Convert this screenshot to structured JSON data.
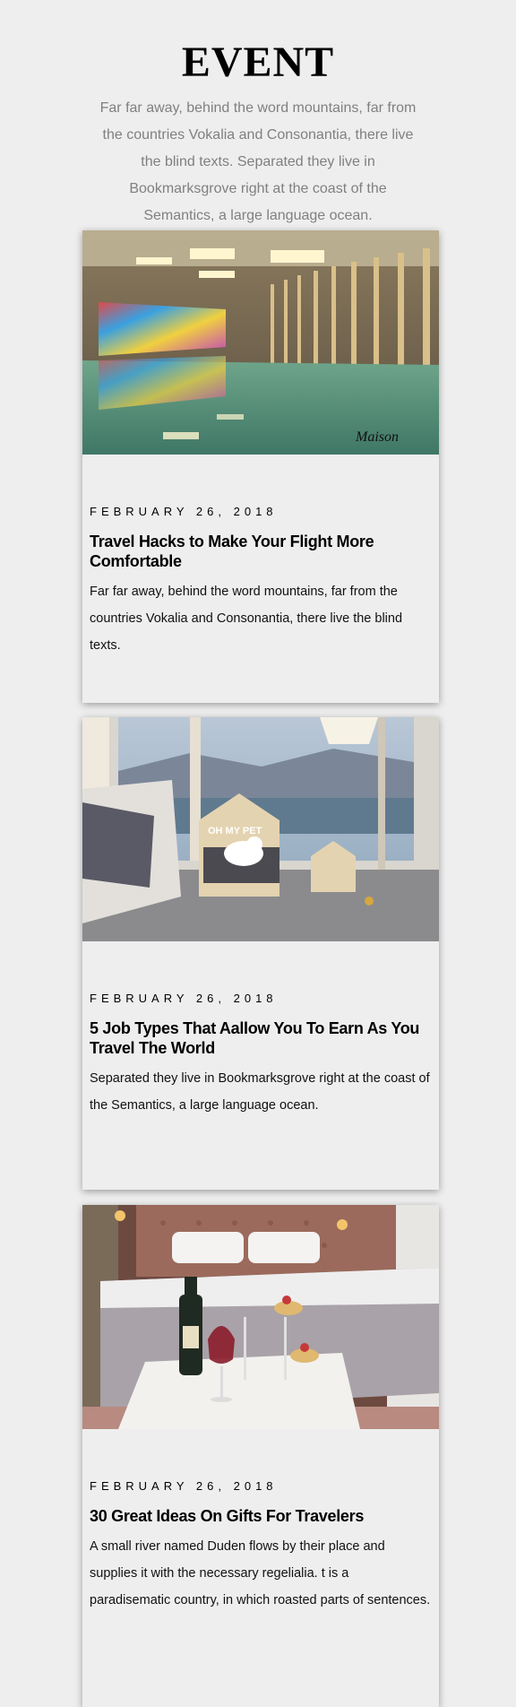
{
  "header": {
    "title": "EVENT",
    "intro": "Far far away, behind the word mountains, far from the countries Vokalia and Consonantia, there live the blind texts. Separated they live in Bookmarksgrove right at the coast of the Semantics, a large language ocean."
  },
  "cards": [
    {
      "image": "indoor-pool-photo",
      "logo_text": "Maison",
      "date": "FEBRUARY 26, 2018",
      "title": "Travel Hacks to Make Your Flight More Comfortable",
      "text": "Far far away, behind the word mountains, far from the countries Vokalia and Consonantia, there live the blind texts."
    },
    {
      "image": "pet-bed-room-photo",
      "sign_text": "OH MY PET",
      "date": "FEBRUARY 26, 2018",
      "title": "5 Job Types That Aallow You To Earn As You Travel The World",
      "text": "Separated they live in Bookmarksgrove right at the coast of the Semantics, a large language ocean."
    },
    {
      "image": "bedroom-champagne-photo",
      "date": "FEBRUARY 26, 2018",
      "title": "30 Great Ideas On Gifts For Travelers",
      "text": "A small river named Duden flows by their place and supplies it with the necessary regelialia. t is a paradisematic country, in which roasted parts of sentences."
    }
  ]
}
